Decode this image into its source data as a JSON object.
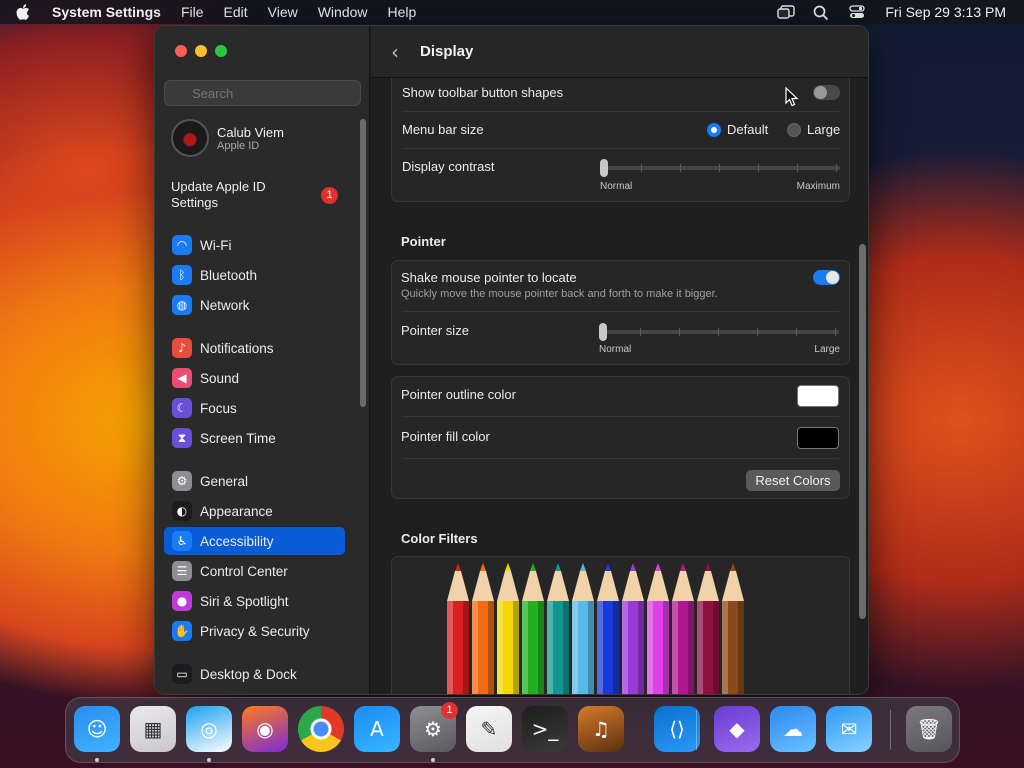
{
  "menubar": {
    "app": "System Settings",
    "menus": [
      "File",
      "Edit",
      "View",
      "Window",
      "Help"
    ],
    "clock": "Fri Sep 29  3:13 PM"
  },
  "sidebar": {
    "search_placeholder": "Search",
    "profile": {
      "name": "Calub Viem",
      "subtitle": "Apple ID"
    },
    "update": {
      "label": "Update Apple ID Settings",
      "badge": "1"
    },
    "items": [
      {
        "label": "Wi-Fi",
        "icon": "wifi-icon",
        "color": "#1a7cf5"
      },
      {
        "label": "Bluetooth",
        "icon": "bluetooth-icon",
        "color": "#1a7cf5"
      },
      {
        "label": "Network",
        "icon": "globe-icon",
        "color": "#1a7cf5"
      },
      {
        "label": "Notifications",
        "icon": "bell-icon",
        "color": "#eb4d3d"
      },
      {
        "label": "Sound",
        "icon": "speaker-icon",
        "color": "#eb4d72"
      },
      {
        "label": "Focus",
        "icon": "moon-icon",
        "color": "#6a4fd8"
      },
      {
        "label": "Screen Time",
        "icon": "hourglass-icon",
        "color": "#6a4fd8"
      },
      {
        "label": "General",
        "icon": "gear-icon",
        "color": "#8e8e93"
      },
      {
        "label": "Appearance",
        "icon": "appearance-icon",
        "color": "#1c1c1e"
      },
      {
        "label": "Accessibility",
        "icon": "accessibility-icon",
        "color": "#1a7cf5"
      },
      {
        "label": "Control Center",
        "icon": "toggles-icon",
        "color": "#8e8e93"
      },
      {
        "label": "Siri & Spotlight",
        "icon": "siri-icon",
        "color": "#c03ad8"
      },
      {
        "label": "Privacy & Security",
        "icon": "hand-icon",
        "color": "#1a7cf5"
      },
      {
        "label": "Desktop & Dock",
        "icon": "dock-icon",
        "color": "#1c1c1e"
      }
    ],
    "active": "Accessibility"
  },
  "main": {
    "title": "Display",
    "display_card": {
      "toolbar_shapes": {
        "label": "Show toolbar button shapes",
        "on": false
      },
      "menu_bar_size": {
        "label": "Menu bar size",
        "options": [
          "Default",
          "Large"
        ],
        "selected": "Default"
      },
      "contrast": {
        "label": "Display contrast",
        "min_label": "Normal",
        "max_label": "Maximum",
        "value": 0
      }
    },
    "pointer": {
      "heading": "Pointer",
      "shake": {
        "label": "Shake mouse pointer to locate",
        "description": "Quickly move the mouse pointer back and forth to make it bigger.",
        "on": true
      },
      "size": {
        "label": "Pointer size",
        "min_label": "Normal",
        "max_label": "Large",
        "value": 0
      }
    },
    "colors": {
      "outline": {
        "label": "Pointer outline color",
        "color": "#ffffff"
      },
      "fill": {
        "label": "Pointer fill color",
        "color": "#000000"
      },
      "reset": "Reset Colors"
    },
    "filters": {
      "heading": "Color Filters"
    }
  },
  "pencil_colors": [
    "#d82020",
    "#f06a18",
    "#f2d800",
    "#22b022",
    "#109890",
    "#58b8e8",
    "#1a3ad8",
    "#9a38d8",
    "#e040e8",
    "#b01890",
    "#901040",
    "#8a4a1a"
  ],
  "dock": {
    "badge": "1",
    "apps": [
      "Finder",
      "Launchpad",
      "Safari",
      "Firefox",
      "Chrome",
      "App Store",
      "System Settings",
      "TextEdit",
      "Terminal",
      "GarageBand",
      "Visual Studio Code",
      "Visual Studio",
      "Weather",
      "Mail",
      "Trash"
    ]
  }
}
